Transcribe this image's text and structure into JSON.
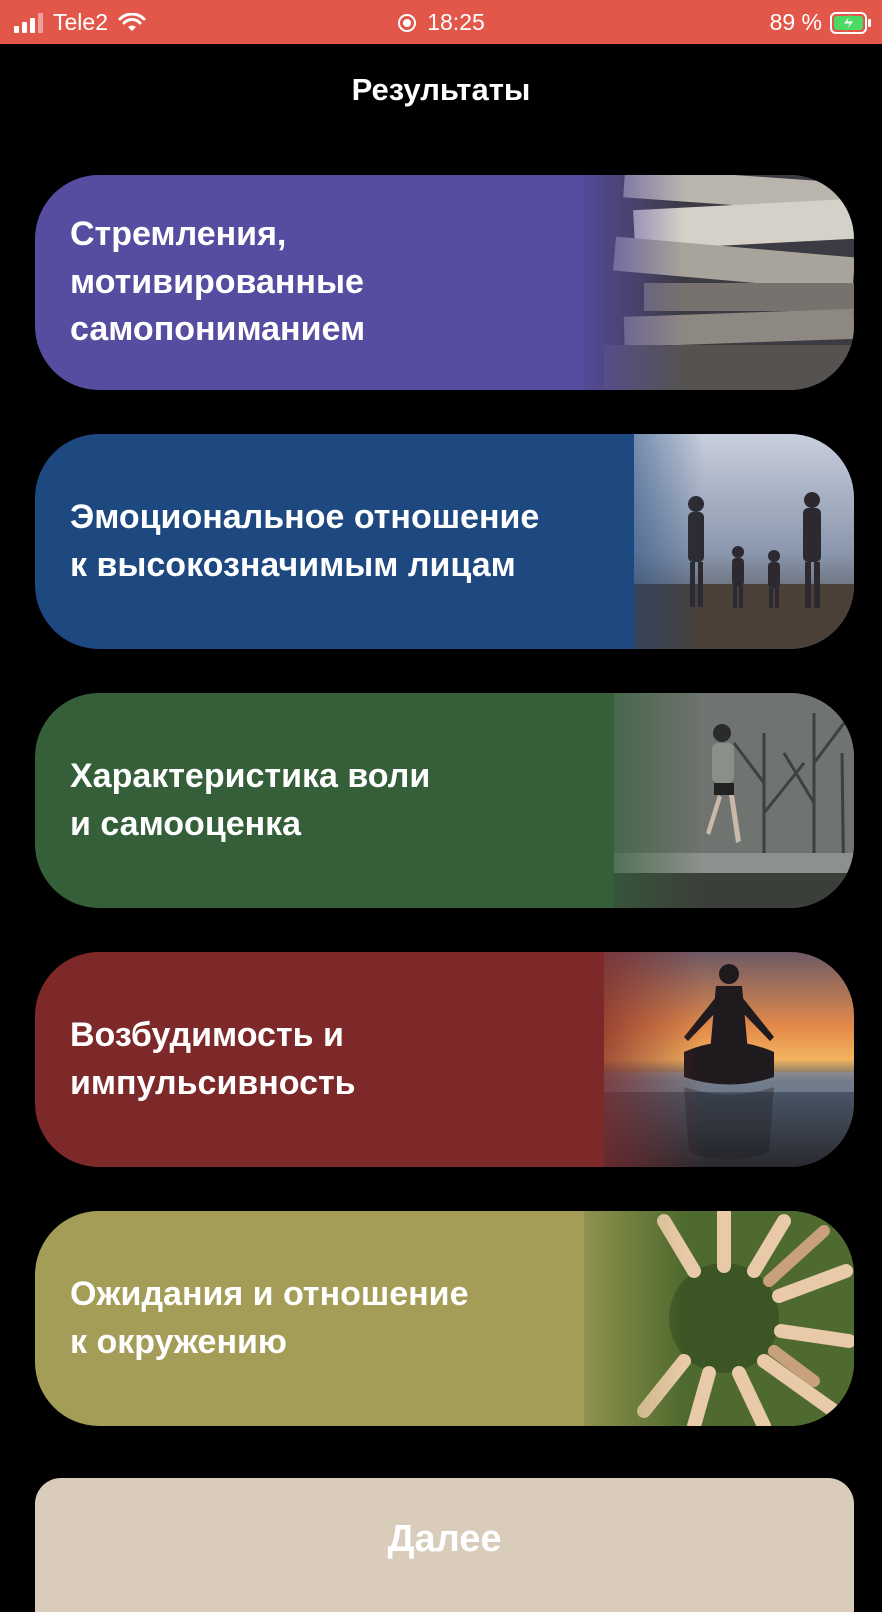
{
  "status_bar": {
    "carrier": "Tele2",
    "time": "18:25",
    "battery": "89 %"
  },
  "nav": {
    "title": "Результаты"
  },
  "cards": [
    {
      "label": "Стремления,\nмотивированные\nсамопониманием",
      "color": "#564ca0",
      "photo": "books-photo"
    },
    {
      "label": "Эмоциональное отношение\nк высокозначимым лицам",
      "color": "#1d4880",
      "photo": "family-beach-photo"
    },
    {
      "label": "Характеристика воли\nи самооценка",
      "color": "#355f39",
      "photo": "runner-photo"
    },
    {
      "label": "Возбудимость и\nимпульсивность",
      "color": "#7d2929",
      "photo": "meditation-sunset-photo"
    },
    {
      "label": "Ожидания и отношение\nк окружению",
      "color": "#a39d57",
      "photo": "hands-circle-photo"
    }
  ],
  "next_button": {
    "label": "Далее",
    "color": "#d9ccbb"
  }
}
